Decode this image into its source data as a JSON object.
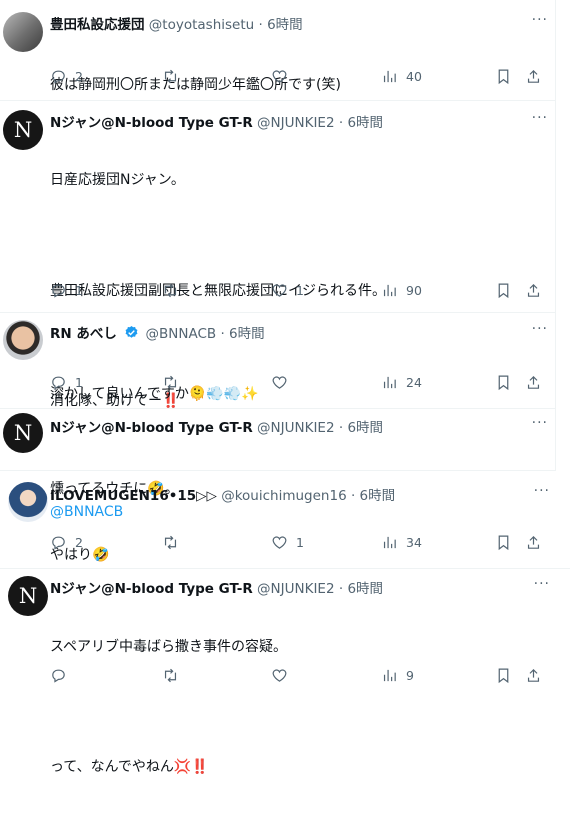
{
  "tweets": [
    {
      "name": "豊田私設応援団",
      "handle": "@toyotashisetu",
      "time": "6時間",
      "lines": [
        "彼は静岡刑〇所または静岡少年鑑〇所です(笑)"
      ],
      "replies": "2",
      "retweets": "",
      "likes": "",
      "views": "40"
    },
    {
      "name": "Nジャン@N-blood Type GT-R",
      "handle": "@NJUNKIE2",
      "time": "6時間",
      "lines": [
        "日産応援団Nジャン。",
        "",
        "豊田私設応援団副団長と無限応援団にイジられる件。",
        "",
        "消化隊、助けてー‼️",
        ""
      ],
      "link": "@BNNACB",
      "replies": "1",
      "retweets": "",
      "likes": "1",
      "views": "90"
    },
    {
      "name": "RN あべし",
      "handle": "@BNNACB",
      "time": "6時間",
      "lines": [
        "溶かして良いんですか🫠💨💨✨"
      ],
      "replies": "1",
      "retweets": "",
      "likes": "",
      "views": "24"
    },
    {
      "name": "Nジャン@N-blood Type GT-R",
      "handle": "@NJUNKIE2",
      "time": "6時間",
      "lines": [
        "燻ってるウチに🤣。"
      ]
    },
    {
      "name": "ILOVEMUGEN16•15▷▷",
      "handle": "@kouichimugen16",
      "time": "6時間",
      "lines": [
        "やはり🤣"
      ],
      "replies": "2",
      "retweets": "",
      "likes": "1",
      "views": "34"
    },
    {
      "name": "Nジャン@N-blood Type GT-R",
      "handle": "@NJUNKIE2",
      "time": "6時間",
      "lines": [
        "スペアリブ中毒ばら撒き事件の容疑。",
        "",
        "って、なんでやねん💢‼️"
      ],
      "replies": "",
      "retweets": "",
      "likes": "",
      "views": "9"
    }
  ],
  "separator": "·",
  "more_label": "···",
  "icons": {
    "reply": "reply-icon",
    "retweet": "retweet-icon",
    "like": "like-icon",
    "views": "views-icon",
    "bookmark": "bookmark-icon",
    "share": "share-icon",
    "verified": "verified-badge-icon",
    "more": "more-icon"
  },
  "colors": {
    "link": "#1d9bf0",
    "verified": "#1d9bf0",
    "muted": "#536471",
    "text": "#0f1419"
  }
}
